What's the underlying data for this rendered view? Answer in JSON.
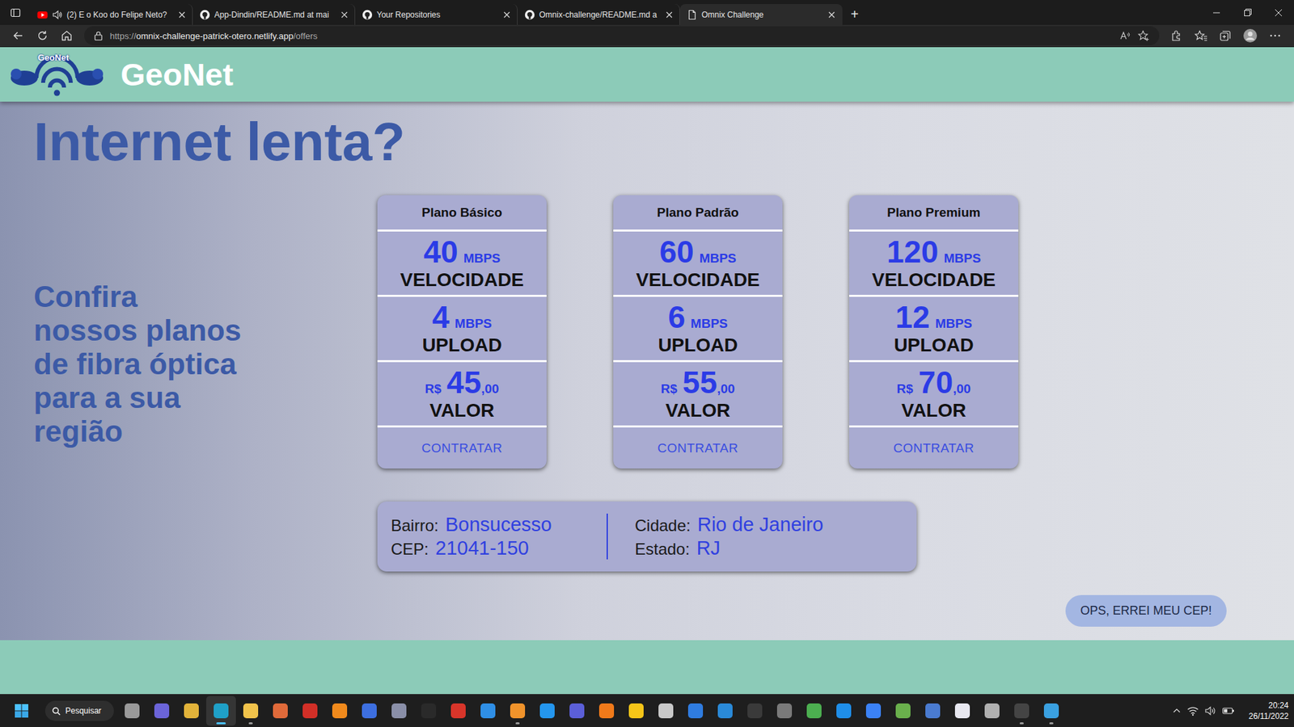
{
  "browser": {
    "tabs": [
      {
        "label": "(2) E o Koo do Felipe Neto?",
        "kind": "youtube",
        "audio": true,
        "selected": false
      },
      {
        "label": "App-Dindin/README.md at mai",
        "kind": "github",
        "audio": false,
        "selected": false
      },
      {
        "label": "Your Repositories",
        "kind": "github",
        "audio": false,
        "selected": false
      },
      {
        "label": "Omnix-challenge/README.md a",
        "kind": "github",
        "audio": false,
        "selected": false
      },
      {
        "label": "Omnix Challenge",
        "kind": "page",
        "audio": false,
        "selected": true
      }
    ],
    "new_tab": "+",
    "address": {
      "scheme": "https://",
      "host": "omnix-challenge-patrick-otero.netlify.app",
      "path": "/offers"
    }
  },
  "page": {
    "logo_text": "GeoNet",
    "brand": "GeoNet",
    "headline": "Internet lenta?",
    "tagline_lines": [
      "Confira",
      "nossos planos",
      "de fibra óptica",
      "para a sua",
      "região"
    ],
    "plans": [
      {
        "name": "Plano Básico",
        "speed": "40",
        "speed_unit": "MBPS",
        "speed_label": "VELOCIDADE",
        "upload": "4",
        "upload_unit": "MBPS",
        "upload_label": "UPLOAD",
        "currency": "R$",
        "price": "45",
        "cents": ",00",
        "price_label": "VALOR",
        "action": "CONTRATAR"
      },
      {
        "name": "Plano Padrão",
        "speed": "60",
        "speed_unit": "MBPS",
        "speed_label": "VELOCIDADE",
        "upload": "6",
        "upload_unit": "MBPS",
        "upload_label": "UPLOAD",
        "currency": "R$",
        "price": "55",
        "cents": ",00",
        "price_label": "VALOR",
        "action": "CONTRATAR"
      },
      {
        "name": "Plano Premium",
        "speed": "120",
        "speed_unit": "MBPS",
        "speed_label": "VELOCIDADE",
        "upload": "12",
        "upload_unit": "MBPS",
        "upload_label": "UPLOAD",
        "currency": "R$",
        "price": "70",
        "cents": ",00",
        "price_label": "VALOR",
        "action": "CONTRATAR"
      }
    ],
    "location": {
      "columns": [
        [
          {
            "label": "Bairro:",
            "value": "Bonsucesso"
          },
          {
            "label": "CEP:",
            "value": "21041-150"
          }
        ],
        [
          {
            "label": "Cidade:",
            "value": "Rio de Janeiro"
          },
          {
            "label": "Estado:",
            "value": "RJ"
          }
        ]
      ]
    },
    "fix_cep_button": "OPS, ERREI MEU CEP!"
  },
  "taskbar": {
    "search": "Pesquisar",
    "apps": [
      {
        "running": false,
        "selected": false
      },
      {
        "running": false,
        "selected": false
      },
      {
        "running": false,
        "selected": false
      },
      {
        "running": true,
        "selected": true
      },
      {
        "running": true,
        "selected": false
      },
      {
        "running": false,
        "selected": false
      },
      {
        "running": false,
        "selected": false
      },
      {
        "running": false,
        "selected": false
      },
      {
        "running": false,
        "selected": false
      },
      {
        "running": false,
        "selected": false
      },
      {
        "running": false,
        "selected": false
      },
      {
        "running": false,
        "selected": false
      },
      {
        "running": false,
        "selected": false
      },
      {
        "running": true,
        "selected": false
      },
      {
        "running": false,
        "selected": false
      },
      {
        "running": false,
        "selected": false
      },
      {
        "running": false,
        "selected": false
      },
      {
        "running": false,
        "selected": false
      },
      {
        "running": false,
        "selected": false
      },
      {
        "running": false,
        "selected": false
      },
      {
        "running": false,
        "selected": false
      },
      {
        "running": false,
        "selected": false
      },
      {
        "running": false,
        "selected": false
      },
      {
        "running": false,
        "selected": false
      },
      {
        "running": false,
        "selected": false
      },
      {
        "running": false,
        "selected": false
      },
      {
        "running": false,
        "selected": false
      },
      {
        "running": false,
        "selected": false
      },
      {
        "running": false,
        "selected": false
      },
      {
        "running": false,
        "selected": false
      },
      {
        "running": true,
        "selected": false
      },
      {
        "running": true,
        "selected": false
      }
    ],
    "time": "20:24",
    "date": "26/11/2022"
  }
}
